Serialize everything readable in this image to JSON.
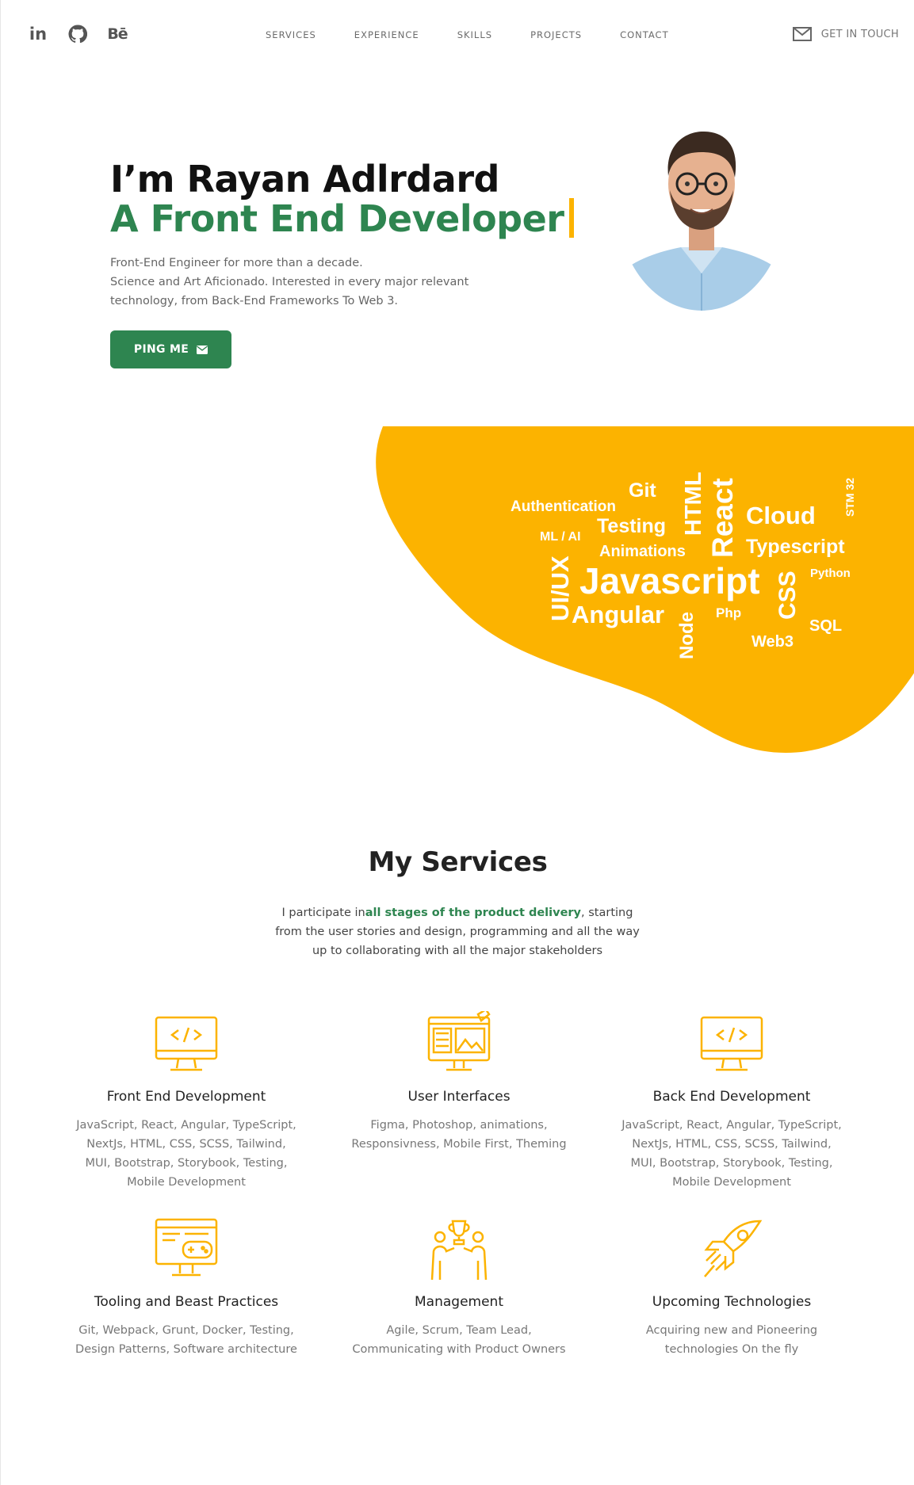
{
  "header": {
    "social": [
      {
        "name": "linkedin-icon",
        "label": "in"
      },
      {
        "name": "github-icon",
        "label": ""
      },
      {
        "name": "behance-icon",
        "label": "Bē"
      }
    ],
    "nav": [
      "SERVICES",
      "EXPERIENCE",
      "SKILLS",
      "PROJECTS",
      "CONTACT"
    ],
    "cta": "GET IN TOUCH"
  },
  "hero": {
    "title": "I’m Rayan Adlrdard",
    "subtitle": "A Front End Developer",
    "desc_lines": [
      "Front-End Engineer for more than a decade.",
      "Science and Art Aficionado. Interested in every major relevant",
      "technology, from Back-End Frameworks To Web 3."
    ],
    "button": "PING ME"
  },
  "skills_cloud": {
    "words": [
      "Authentication",
      "Git",
      "HTML",
      "React",
      "Cloud",
      "STM 32",
      "ML / AI",
      "Testing",
      "Animations",
      "Typescript",
      "UI/UX",
      "Javascript",
      "Angular",
      "CSS",
      "Python",
      "Node",
      "Php",
      "SQL",
      "Web3"
    ]
  },
  "services": {
    "title": "My Services",
    "intro_pre": "I participate in",
    "intro_bold": "all stages of the product delivery",
    "intro_post": ", starting from the user stories and design, programming and all the way up to collaborating with all the major stakeholders",
    "items": [
      {
        "icon": "monitor-code-icon",
        "title": "Front End Development",
        "desc": "JavaScript, React, Angular, TypeScript, NextJs, HTML, CSS, SCSS, Tailwind, MUI, Bootstrap, Storybook, Testing, Mobile Development"
      },
      {
        "icon": "design-monitor-icon",
        "title": "User Interfaces",
        "desc": "Figma, Photoshop, animations, Responsivness, Mobile First, Theming"
      },
      {
        "icon": "monitor-code-icon",
        "title": "Back End Development",
        "desc": "JavaScript, React, Angular, TypeScript, NextJs, HTML, CSS, SCSS, Tailwind, MUI, Bootstrap, Storybook, Testing, Mobile Development"
      },
      {
        "icon": "gaming-monitor-icon",
        "title": "Tooling and Beast Practices",
        "desc": "Git, Webpack, Grunt, Docker, Testing, Design Patterns, Software architecture"
      },
      {
        "icon": "team-trophy-icon",
        "title": "Management",
        "desc": "Agile, Scrum, Team Lead, Communicating with Product Owners"
      },
      {
        "icon": "rocket-icon",
        "title": "Upcoming Technologies",
        "desc": "Acquiring new and Pioneering technologies On the fly"
      }
    ]
  },
  "colors": {
    "accent_green": "#2e8550",
    "accent_yellow": "#fcb300",
    "text_dark": "#111111"
  }
}
